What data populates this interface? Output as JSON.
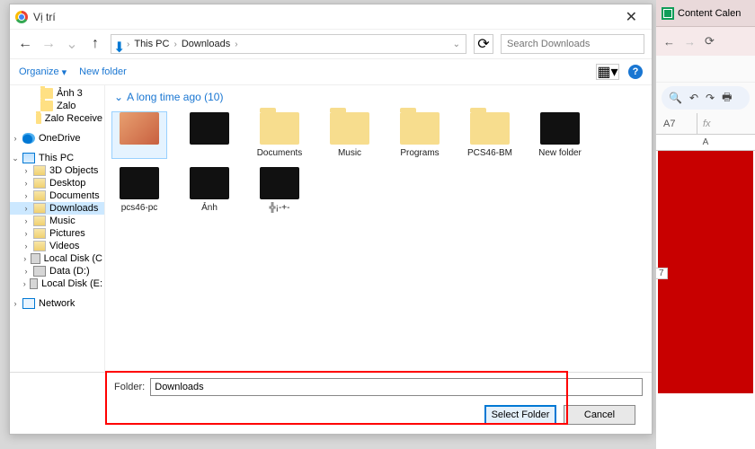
{
  "window": {
    "title": "Vị trí",
    "close": "✕"
  },
  "nav": {
    "crumbs": [
      "This PC",
      "Downloads"
    ],
    "search_placeholder": "Search Downloads"
  },
  "toolbar": {
    "organize": "Organize",
    "newfolder": "New folder"
  },
  "tree": {
    "items": [
      {
        "label": "Ảnh 3",
        "icon": "folder",
        "chev": ""
      },
      {
        "label": "Zalo",
        "icon": "folder",
        "chev": ""
      },
      {
        "label": "Zalo Receive",
        "icon": "folder",
        "chev": ""
      },
      {
        "label": "",
        "icon": "",
        "chev": ""
      },
      {
        "label": "OneDrive",
        "icon": "onedrive",
        "chev": "›"
      },
      {
        "label": "",
        "icon": "",
        "chev": ""
      },
      {
        "label": "This PC",
        "icon": "pc",
        "chev": "⌄"
      },
      {
        "label": "3D Objects",
        "icon": "sys",
        "chev": "›"
      },
      {
        "label": "Desktop",
        "icon": "sys",
        "chev": "›"
      },
      {
        "label": "Documents",
        "icon": "sys",
        "chev": "›"
      },
      {
        "label": "Downloads",
        "icon": "sys",
        "chev": "›",
        "sel": true
      },
      {
        "label": "Music",
        "icon": "sys",
        "chev": "›"
      },
      {
        "label": "Pictures",
        "icon": "sys",
        "chev": "›"
      },
      {
        "label": "Videos",
        "icon": "sys",
        "chev": "›"
      },
      {
        "label": "Local Disk (C",
        "icon": "disk",
        "chev": "›"
      },
      {
        "label": "Data (D:)",
        "icon": "disk",
        "chev": "›"
      },
      {
        "label": "Local Disk (E:",
        "icon": "disk",
        "chev": "›"
      },
      {
        "label": "",
        "icon": "",
        "chev": ""
      },
      {
        "label": "Network",
        "icon": "net",
        "chev": "›"
      }
    ]
  },
  "content": {
    "group": "A long time ago (10)",
    "items": [
      {
        "name": "",
        "kind": "photo",
        "sel": true
      },
      {
        "name": "",
        "kind": "thumb"
      },
      {
        "name": "Documents",
        "kind": "folder"
      },
      {
        "name": "Music",
        "kind": "folder"
      },
      {
        "name": "Programs",
        "kind": "folder"
      },
      {
        "name": "PCS46-BM",
        "kind": "folder"
      },
      {
        "name": "New folder",
        "kind": "thumb"
      },
      {
        "name": "pcs46-pc",
        "kind": "thumb"
      },
      {
        "name": "Ảnh",
        "kind": "thumb"
      },
      {
        "name": "╬¡-+-",
        "kind": "thumb"
      }
    ]
  },
  "footer": {
    "label": "Folder:",
    "value": "Downloads",
    "select": "Select Folder",
    "cancel": "Cancel"
  },
  "right": {
    "tab": "Content Calen",
    "cellref": "A7",
    "fx": "fx",
    "col": "A",
    "row": "7"
  }
}
